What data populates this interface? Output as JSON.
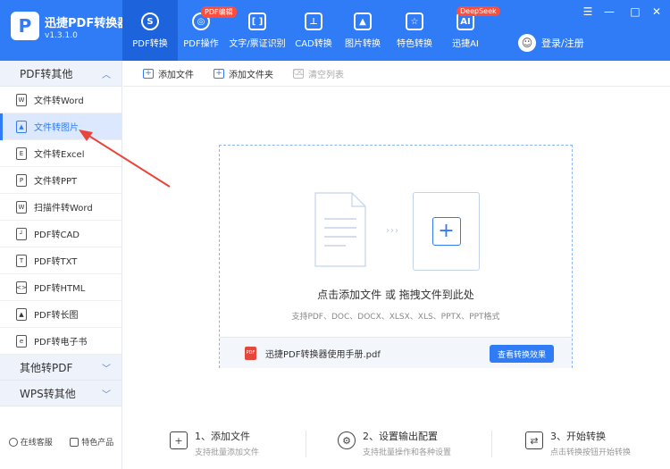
{
  "app": {
    "logo_letter": "P",
    "title": "迅捷PDF转换器",
    "version": "v1.3.1.0"
  },
  "nav": [
    {
      "label": "PDF转换",
      "icon": "convert-icon",
      "active": true,
      "badge": ""
    },
    {
      "label": "PDF操作",
      "icon": "pdf-operate-icon",
      "active": false,
      "badge": "PDF编辑"
    },
    {
      "label": "文字/票证识别",
      "icon": "ocr-icon",
      "active": false,
      "badge": ""
    },
    {
      "label": "CAD转换",
      "icon": "cad-icon",
      "active": false,
      "badge": ""
    },
    {
      "label": "图片转换",
      "icon": "image-icon",
      "active": false,
      "badge": ""
    },
    {
      "label": "特色转换",
      "icon": "star-icon",
      "active": false,
      "badge": ""
    },
    {
      "label": "迅捷AI",
      "icon": "ai-icon",
      "active": false,
      "badge": "DeepSeek"
    }
  ],
  "user": {
    "login_label": "登录/注册"
  },
  "sidebar": {
    "group1": "PDF转其他",
    "items": [
      {
        "label": "文件转Word",
        "icon": "word-file-icon",
        "active": false
      },
      {
        "label": "文件转图片",
        "icon": "image-file-icon",
        "active": true
      },
      {
        "label": "文件转Excel",
        "icon": "excel-file-icon",
        "active": false
      },
      {
        "label": "文件转PPT",
        "icon": "ppt-file-icon",
        "active": false
      },
      {
        "label": "扫描件转Word",
        "icon": "scan-file-icon",
        "active": false
      },
      {
        "label": "PDF转CAD",
        "icon": "cad-file-icon",
        "active": false
      },
      {
        "label": "PDF转TXT",
        "icon": "txt-file-icon",
        "active": false
      },
      {
        "label": "PDF转HTML",
        "icon": "html-file-icon",
        "active": false
      },
      {
        "label": "PDF转长图",
        "icon": "long-image-icon",
        "active": false
      },
      {
        "label": "PDF转电子书",
        "icon": "ebook-file-icon",
        "active": false
      }
    ],
    "group2": "其他转PDF",
    "group3": "WPS转其他",
    "footer": {
      "service": "在线客服",
      "featured": "特色产品"
    }
  },
  "toolbar": {
    "add_file": "添加文件",
    "add_folder": "添加文件夹",
    "clear_list": "清空列表"
  },
  "dropzone": {
    "title": "点击添加文件 或 拖拽文件到此处",
    "formats": "支持PDF、DOC、DOCX、XLSX、XLS、PPTX、PPT格式",
    "manual_file": "迅捷PDF转换器使用手册.pdf",
    "view_button": "查看转换效果"
  },
  "steps": [
    {
      "title": "1、添加文件",
      "sub": "支持批量添加文件",
      "icon": "add-file-step-icon"
    },
    {
      "title": "2、设置输出配置",
      "sub": "支持批量操作和各种设置",
      "icon": "settings-gear-icon"
    },
    {
      "title": "3、开始转换",
      "sub": "点击转换按钮开始转换",
      "icon": "start-convert-icon"
    }
  ],
  "colors": {
    "primary": "#2f7cf6",
    "active_nav": "#1c63dc",
    "badge": "#ff4d3d",
    "annotation_arrow": "#e8463a"
  }
}
